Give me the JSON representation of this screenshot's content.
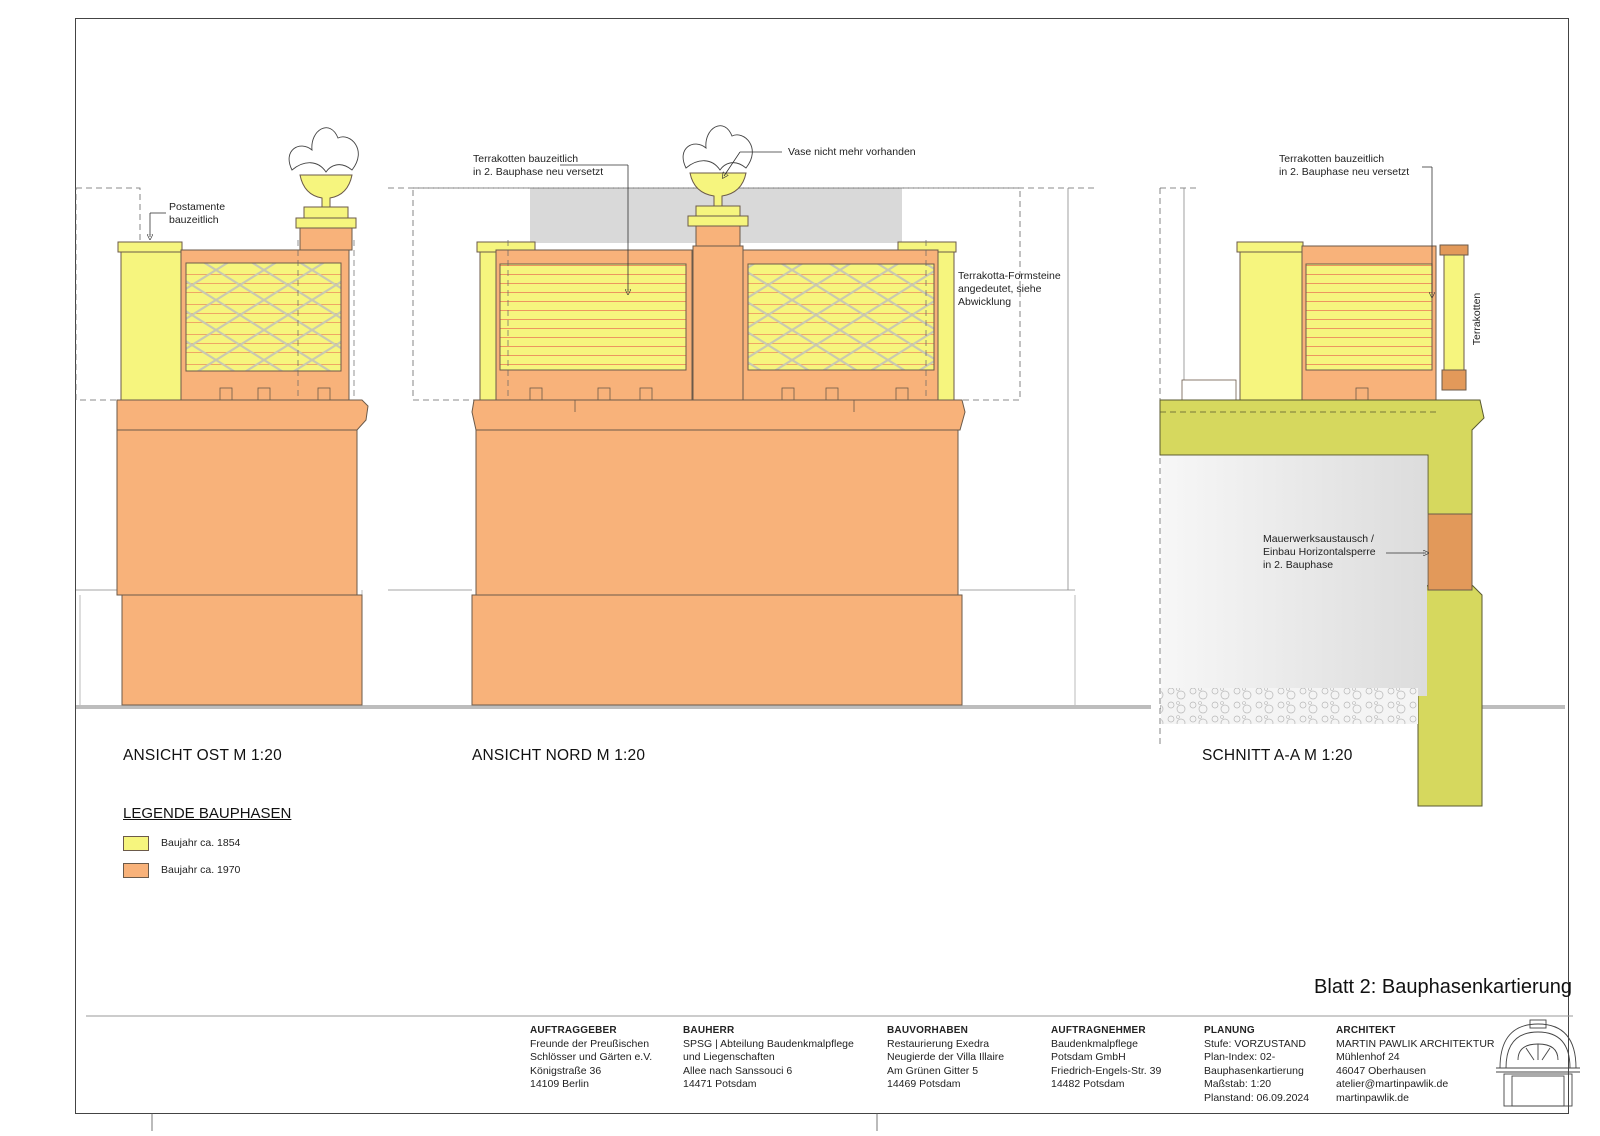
{
  "views": {
    "east": "ANSICHT OST M 1:20",
    "north": "ANSICHT NORD M 1:20",
    "section": "SCHNITT A-A M 1:20"
  },
  "annotations": {
    "postamente": "Postamente\nbauzeitlich",
    "terrakotten_north": "Terrakotten bauzeitlich\nin 2. Bauphase neu versetzt",
    "vase": "Vase nicht mehr vorhanden",
    "formsteine": "Terrakotta-Formsteine\nangedeutet, siehe\nAbwicklung",
    "terrakotten_section": "Terrakotten bauzeitlich\nin 2. Bauphase neu versetzt",
    "terrakotten_vertical": "Terrakotten",
    "mauerwerk": "Mauerwerksaustausch /\nEinbau Horizontalsperre\nin 2. Bauphase"
  },
  "legend": {
    "title": "LEGENDE BAUPHASEN",
    "items": [
      {
        "label": "Baujahr ca. 1854",
        "color": "#f6f57e"
      },
      {
        "label": "Baujahr ca. 1970",
        "color": "#f8b27a"
      }
    ]
  },
  "colors": {
    "yellow": "#f6f57e",
    "orange": "#f8b27a",
    "section_green": "#d6d85e",
    "section_dark": "#e2995a",
    "grey_bg": "#d9d9d9",
    "hatch_red": "#e8574a"
  },
  "sheet_title": "Blatt 2: Bauphasenkartierung",
  "titleblock": [
    {
      "head": "AUFTRAGGEBER",
      "lines": [
        "Freunde der Preußischen",
        "Schlösser und Gärten e.V.",
        "Königstraße 36",
        "14109 Berlin"
      ]
    },
    {
      "head": "BAUHERR",
      "lines": [
        "SPSG | Abteilung Baudenkmalpflege",
        "und Liegenschaften",
        "Allee nach Sanssouci 6",
        "14471 Potsdam"
      ]
    },
    {
      "head": "BAUVORHABEN",
      "lines": [
        "Restaurierung Exedra",
        "Neugierde der Villa Illaire",
        "Am Grünen Gitter 5",
        "14469 Potsdam"
      ]
    },
    {
      "head": "AUFTRAGNEHMER",
      "lines": [
        "Baudenkmalpflege",
        "Potsdam GmbH",
        "Friedrich-Engels-Str. 39",
        "14482 Potsdam"
      ]
    },
    {
      "head": "PLANUNG",
      "lines": [
        "Stufe: VORZUSTAND",
        "Plan-Index: 02-",
        "Bauphasenkartierung",
        "Maßstab: 1:20",
        "Planstand: 06.09.2024"
      ]
    },
    {
      "head": "ARCHITEKT",
      "lines": [
        "MARTIN PAWLIK ARCHITEKTUR",
        "Mühlenhof 24",
        "46047 Oberhausen",
        "atelier@martinpawlik.de",
        "martinpawlik.de"
      ]
    }
  ]
}
